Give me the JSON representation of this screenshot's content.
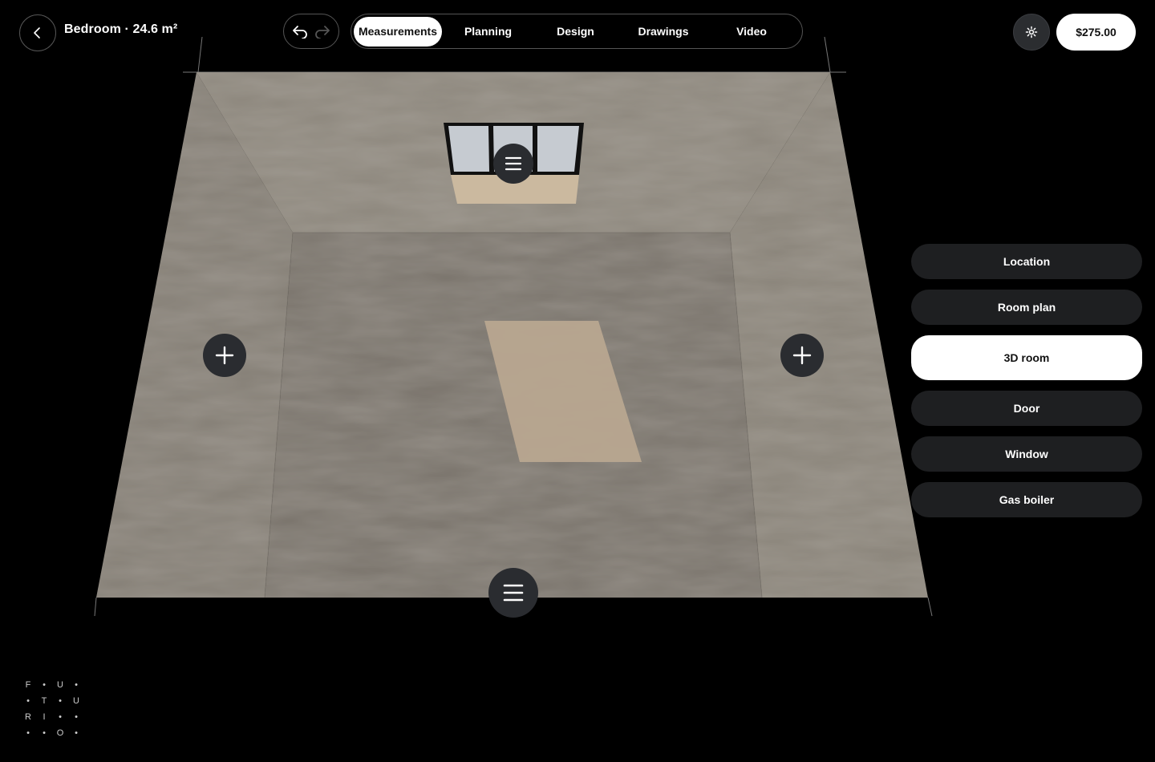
{
  "header": {
    "title": "Bedroom · 24.6 m²",
    "price": "$275.00"
  },
  "tabs": [
    {
      "label": "Measurements",
      "active": true
    },
    {
      "label": "Planning",
      "active": false
    },
    {
      "label": "Design",
      "active": false
    },
    {
      "label": "Drawings",
      "active": false
    },
    {
      "label": "Video",
      "active": false
    }
  ],
  "side_menu": [
    {
      "label": "Location",
      "active": false
    },
    {
      "label": "Room plan",
      "active": false
    },
    {
      "label": "3D room",
      "active": true
    },
    {
      "label": "Door",
      "active": false
    },
    {
      "label": "Window",
      "active": false
    },
    {
      "label": "Gas boiler",
      "active": false
    }
  ],
  "icons": {
    "back": "chevron-left-icon",
    "undo": "undo-icon",
    "redo": "redo-icon",
    "settings": "gear-icon",
    "wall_menu": "menu-icon",
    "add": "plus-icon"
  },
  "logo": [
    "F",
    "•",
    "U",
    "•",
    "•",
    "T",
    "•",
    "U",
    "R",
    "I",
    "•",
    "•",
    "•",
    "•",
    "O",
    "•"
  ],
  "colors": {
    "background": "#000000",
    "wall": "#8a8278",
    "floor": "#7d776f",
    "rug": "#b3a38c",
    "active_bg": "#ffffff",
    "button_bg": "#1e1f21"
  }
}
